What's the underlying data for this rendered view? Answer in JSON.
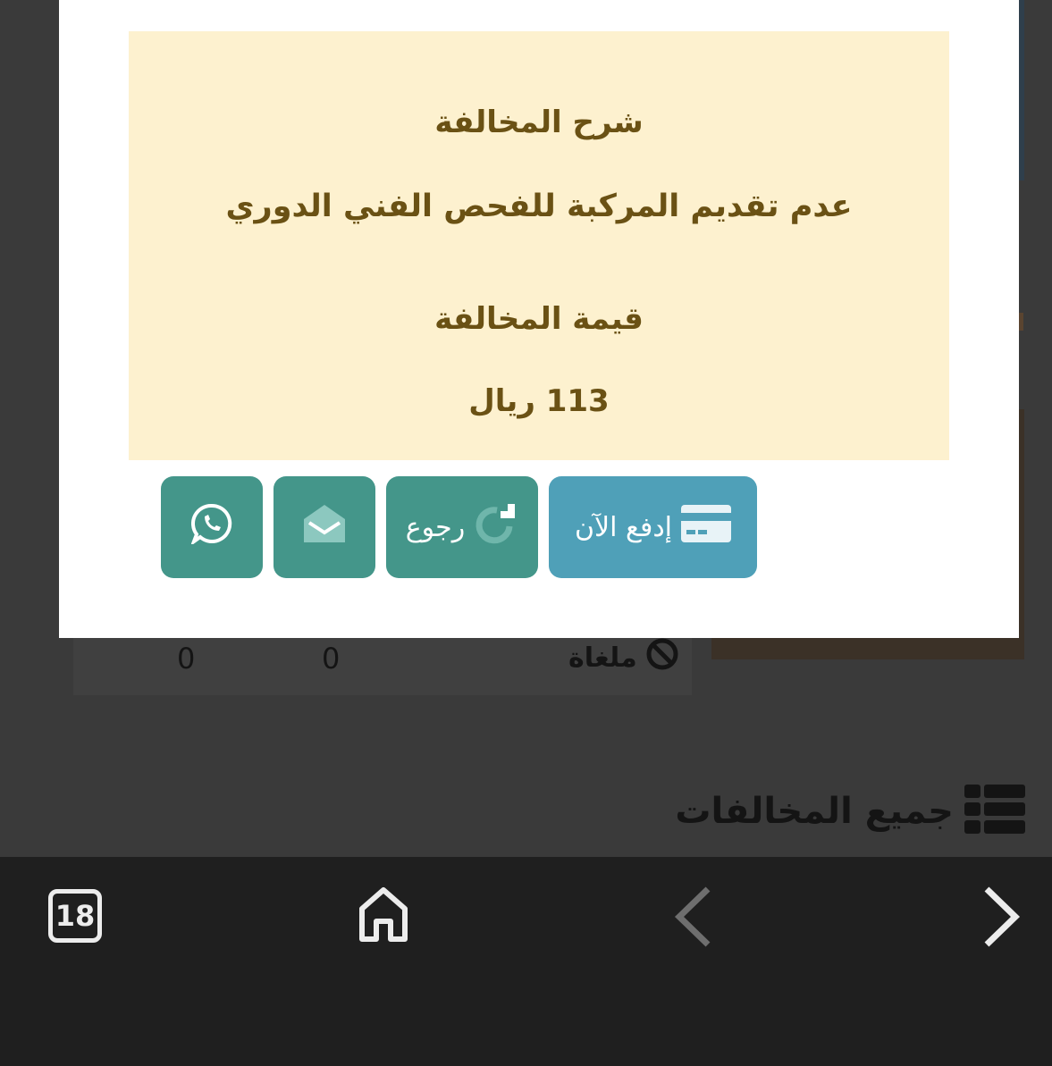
{
  "modal": {
    "description_heading": "شرح المخالفة",
    "description_text": "عدم تقديم المركبة للفحص الفني الدوري",
    "amount_heading": "قيمة المخالفة",
    "amount_text": "113 ريال",
    "buttons": {
      "pay_label": "إدفع الآن",
      "back_label": "رجوع"
    }
  },
  "background": {
    "cancelled_label": "ملغاة",
    "cancelled_count_1": "0",
    "cancelled_count_2": "0",
    "all_violations_label": "جميع المخالفات"
  },
  "browser_bar": {
    "tabs_count": "18"
  },
  "colors": {
    "info_bg": "#fdf1cf",
    "info_text": "#6a5114",
    "pay_button": "#4fa0b8",
    "teal_button": "#44968a"
  }
}
